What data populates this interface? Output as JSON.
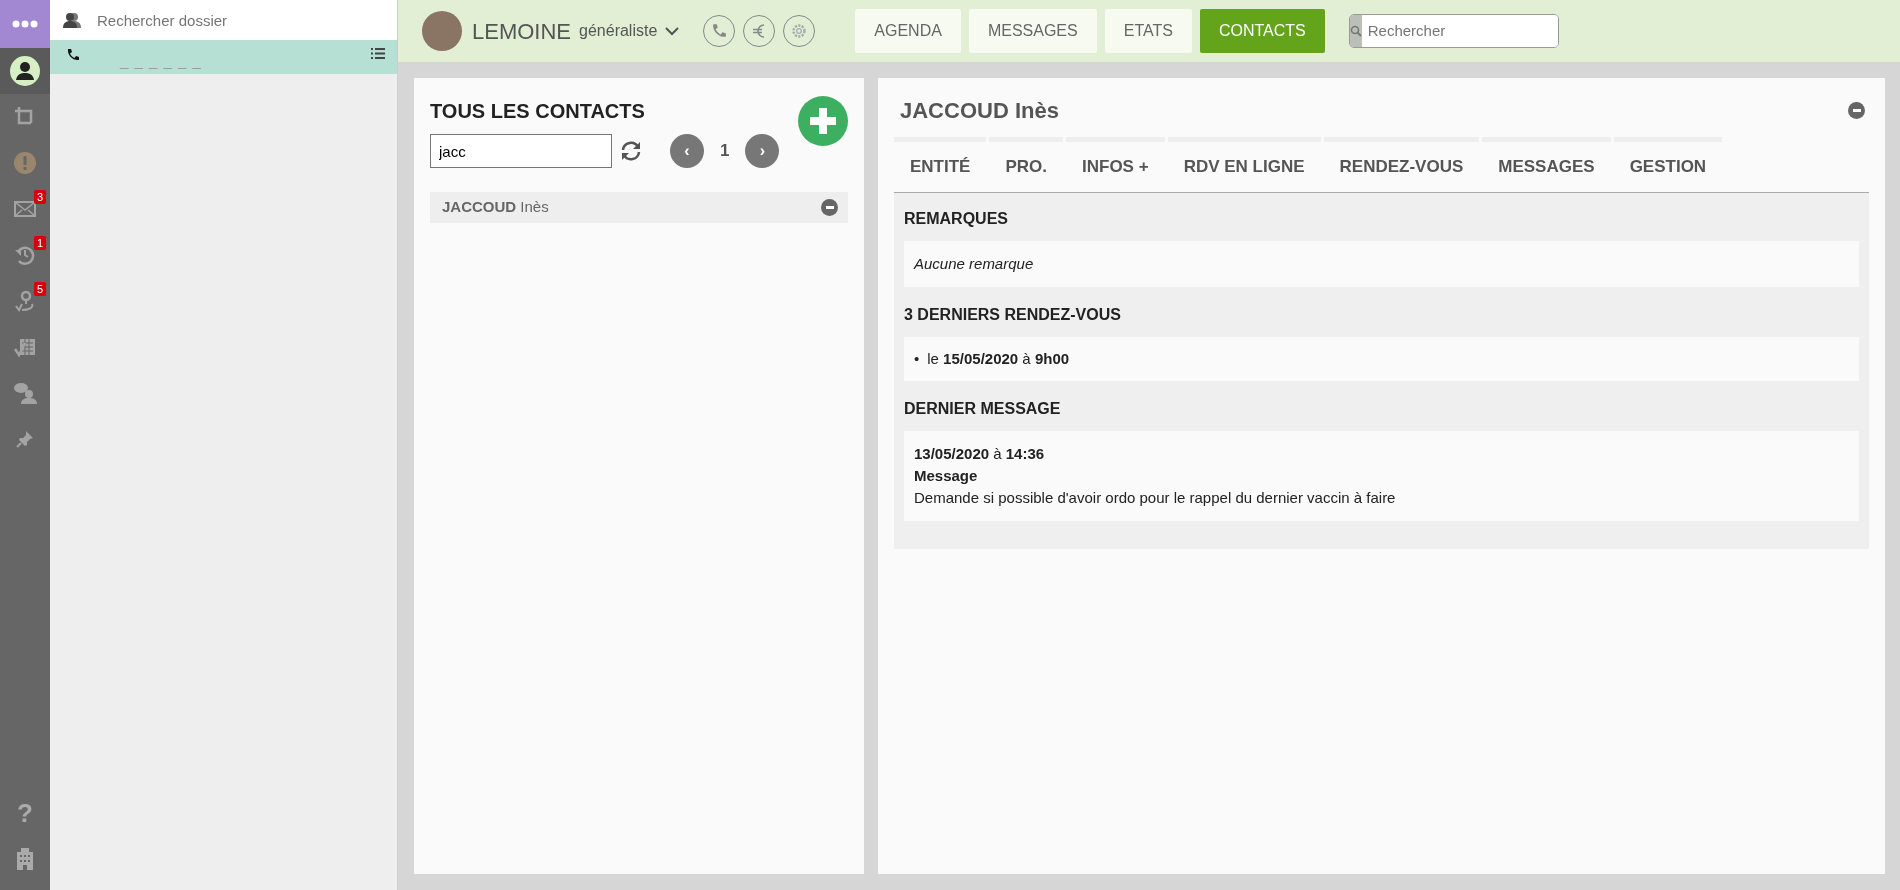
{
  "rail": [
    {
      "kind": "user",
      "selected": true
    },
    {
      "kind": "loop",
      "selected": false
    },
    {
      "kind": "alert",
      "selected": false
    },
    {
      "kind": "mail",
      "selected": false,
      "badge": "3"
    },
    {
      "kind": "history",
      "selected": false,
      "badge": "1"
    },
    {
      "kind": "route",
      "selected": false,
      "badge": "5"
    },
    {
      "kind": "calendar",
      "selected": false
    },
    {
      "kind": "chat",
      "selected": false
    },
    {
      "kind": "pin",
      "selected": false
    }
  ],
  "rail_bottom": [
    {
      "kind": "help",
      "label": "?"
    },
    {
      "kind": "building"
    }
  ],
  "side": {
    "search_placeholder": "Rechercher dossier",
    "call_number": "_ _ _ _ _ _"
  },
  "header": {
    "user": "LEMOINE",
    "role": "généraliste",
    "nav": [
      {
        "label": "AGENDA",
        "selected": false
      },
      {
        "label": "MESSAGES",
        "selected": false
      },
      {
        "label": "ETATS",
        "selected": false
      },
      {
        "label": "CONTACTS",
        "selected": true
      }
    ],
    "search_placeholder": "Rechercher"
  },
  "contacts": {
    "title": "TOUS LES CONTACTS",
    "filter": "jacc",
    "page": "1",
    "prev": "‹",
    "next": "›",
    "items": [
      {
        "last": "JACCOUD",
        "first": "Inès"
      }
    ]
  },
  "detail": {
    "name": "JACCOUD Inès",
    "tabs": [
      {
        "label": "ENTITÉ",
        "selected": false
      },
      {
        "label": "PRO.",
        "selected": false
      },
      {
        "label": "INFOS +",
        "selected": false
      },
      {
        "label": "RDV EN LIGNE",
        "selected": false
      },
      {
        "label": "RENDEZ-VOUS",
        "selected": false
      },
      {
        "label": "MESSAGES",
        "selected": false
      },
      {
        "label": "GESTION",
        "selected": false
      }
    ],
    "remarks_title": "REMARQUES",
    "remarks": "Aucune remarque",
    "appointments_title": "3 DERNIERS RENDEZ-VOUS",
    "appointments": [
      {
        "bullet": "•",
        "text": "le **15/05/2020** à **9h00**"
      }
    ],
    "message_title": "DERNIER MESSAGE",
    "message_date": "**13/05/2020** à **14:36**",
    "message_subject": "Message",
    "message_body": "Demande si possible d'avoir ordo pour le rappel du dernier vaccin à faire"
  }
}
